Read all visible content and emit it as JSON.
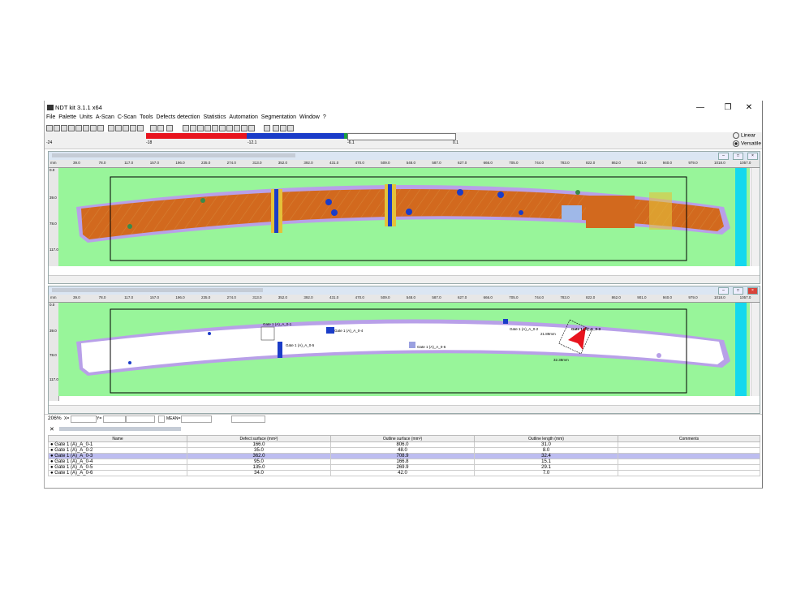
{
  "window": {
    "title": "NDT kit 3.1.1 x64",
    "minimize": "—",
    "maximize": "❐",
    "close": "✕"
  },
  "menu": [
    "File",
    "Palette",
    "Units",
    "A-Scan",
    "C-Scan",
    "Tools",
    "Defects detection",
    "Statistics",
    "Automation",
    "Segmentation",
    "Window",
    "?"
  ],
  "palette": {
    "labels": [
      "-24",
      "-18",
      "-12.1",
      "-6.1",
      "0.1"
    ],
    "colors": {
      "red": "#e8141e",
      "blue": "#1a3cc8",
      "green": "#1ea040",
      "white": "#ffffff"
    },
    "mode_options": [
      "Linear",
      "Versatile"
    ],
    "mode_selected": "Versatile"
  },
  "ruler": {
    "unit": "mm",
    "x_ticks": [
      "39.0",
      "78.0",
      "117.0",
      "157.0",
      "196.0",
      "235.0",
      "274.0",
      "313.0",
      "352.0",
      "392.0",
      "431.0",
      "470.0",
      "509.0",
      "548.0",
      "587.0",
      "627.0",
      "666.0",
      "705.0",
      "744.0",
      "783.0",
      "822.0",
      "862.0",
      "901.0",
      "940.0",
      "979.0",
      "1018.0",
      "1057.0"
    ],
    "y_ticks": [
      "0.0",
      "39.0",
      "78.0",
      "117.0"
    ]
  },
  "defect_labels": [
    "Gate 1 (A)_A_0-1",
    "Gate 1 (A)_A_0-5",
    "Gate 1 (A)_A_0-4",
    "Gate 1 (A)_A_0-6",
    "Gate 1 (A)_A_0-2",
    "Gate 1 (A)_A_0-3"
  ],
  "dimensions": {
    "h": "21.89mm",
    "w": "32.38mm"
  },
  "status": {
    "zoom": "206%",
    "x_label": "X=",
    "y_label": "Y=",
    "mean_label": "MEAN="
  },
  "table": {
    "headers": [
      "Name",
      "Defect surface (mm²)",
      "Outline surface (mm²)",
      "Outline length (mm)",
      "Comments"
    ],
    "rows": [
      {
        "name": "Gate 1 (A)_A_0-1",
        "defect": "166.0",
        "outline_surface": "806.0",
        "outline_length": "31.0",
        "comments": ""
      },
      {
        "name": "Gate 1 (A)_A_0-2",
        "defect": "35.0",
        "outline_surface": "48.0",
        "outline_length": "8.0",
        "comments": ""
      },
      {
        "name": "Gate 1 (A)_A_0-3",
        "defect": "362.0",
        "outline_surface": "708.9",
        "outline_length": "32.4",
        "comments": ""
      },
      {
        "name": "Gate 1 (A)_A_0-4",
        "defect": "95.0",
        "outline_surface": "166.8",
        "outline_length": "15.1",
        "comments": ""
      },
      {
        "name": "Gate 1 (A)_A_0-5",
        "defect": "135.0",
        "outline_surface": "269.9",
        "outline_length": "29.1",
        "comments": ""
      },
      {
        "name": "Gate 1 (A)_A_0-6",
        "defect": "34.0",
        "outline_surface": "42.0",
        "outline_length": "7.0",
        "comments": ""
      }
    ],
    "selected_row": 2
  }
}
